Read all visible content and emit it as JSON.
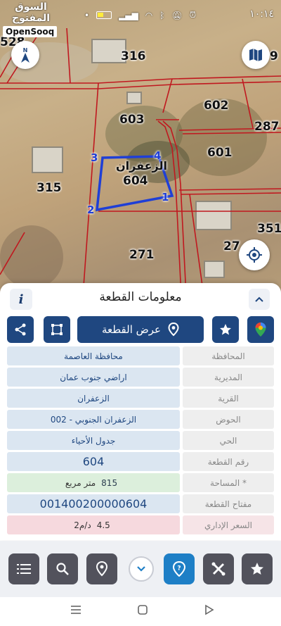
{
  "status_bar": {
    "watermark_ar": "السوق المفتوح",
    "watermark_en": "OpenSooq",
    "time": "١٠:١٤"
  },
  "map": {
    "parcels": {
      "p528": "528",
      "p316": "316",
      "p9": "9",
      "p603": "603",
      "p602": "602",
      "p287": "287",
      "p601": "601",
      "p315": "315",
      "p604": "604",
      "p351": "351",
      "p27": "27",
      "p271": "271"
    },
    "selected_name": "الزعفران",
    "vertices": {
      "v1": "1",
      "v2": "2",
      "v3": "3",
      "v4": "4"
    },
    "selection_color": "#1f3fd6",
    "boundary_color": "#c0181f"
  },
  "sheet": {
    "title": "معلومات القطعة",
    "info_label": "i",
    "show_parcel_label": "عرض القطعة",
    "rows": [
      {
        "label": "المحافظة",
        "value": "محافظة العاصمة"
      },
      {
        "label": "المديرية",
        "value": "اراضي جنوب عمان"
      },
      {
        "label": "القرية",
        "value": "الزعفران"
      },
      {
        "label": "الحوض",
        "value": "الزعفران الجنوبي - 002"
      },
      {
        "label": "الحي",
        "value": "جدول الأحياء"
      },
      {
        "label": "رقم القطعة",
        "value": "604"
      },
      {
        "label": "المساحة *",
        "value": "815",
        "unit": "متر مربع"
      },
      {
        "label": "مفتاح القطعة",
        "value": "001400200000604"
      },
      {
        "label": "السعر الإداري",
        "value": "4.5",
        "unit": "د/م2"
      }
    ]
  },
  "colors": {
    "primary": "#1f4780",
    "active": "#1e7fc6",
    "value_bg": "#dbe6f1",
    "area_bg": "#dcefdc",
    "price_bg": "#f6d9de"
  }
}
